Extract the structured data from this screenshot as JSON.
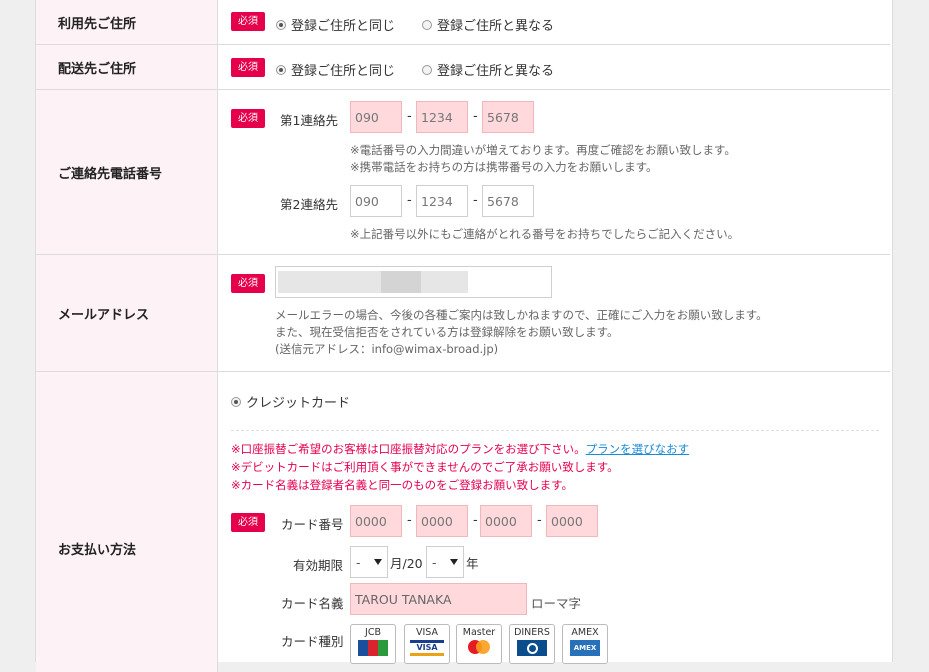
{
  "required_label": "必須",
  "rows": {
    "usage_address": {
      "label": "利用先ご住所",
      "option_same": "登録ご住所と同じ",
      "option_diff": "登録ご住所と異なる"
    },
    "delivery_address": {
      "label": "配送先ご住所",
      "option_same": "登録ご住所と同じ",
      "option_diff": "登録ご住所と異なる"
    },
    "phone": {
      "label": "ご連絡先電話番号",
      "first_label": "第1連絡先",
      "first_values": [
        "090",
        "1234",
        "5678"
      ],
      "first_notes": [
        "※電話番号の入力間違いが増えております。再度ご確認をお願い致します。",
        "※携帯電話をお持ちの方は携帯番号の入力をお願いします。"
      ],
      "second_label": "第2連絡先",
      "second_values": [
        "090",
        "1234",
        "5678"
      ],
      "second_note": "※上記番号以外にもご連絡がとれる番号をお持ちでしたらご記入ください。",
      "separator": "-"
    },
    "email": {
      "label": "メールアドレス",
      "notes": [
        "メールエラーの場合、今後の各種ご案内は致しかねますので、正確にご入力をお願い致します。",
        "また、現在受信拒否をされている方は登録解除をお願い致します。",
        "(送信元アドレス：info@wimax-broad.jp)"
      ]
    },
    "payment": {
      "label": "お支払い方法",
      "method": "クレジットカード",
      "warning1_prefix": "※口座振替ご希望のお客様は口座振替対応のプランをお選び下さい。",
      "warning1_link": "プランを選びなおす",
      "warning2": "※デビットカードはご利用頂く事ができませんのでご了承お願い致します。",
      "warning3": "※カード名義は登録者名義と同一のものをご登録お願い致します。",
      "card_number_label": "カード番号",
      "card_number_values": [
        "0000",
        "0000",
        "0000",
        "0000"
      ],
      "expiry_label": "有効期限",
      "expiry_month": "-",
      "expiry_month_suffix": "月/20",
      "expiry_year": "-",
      "expiry_year_suffix": "年",
      "card_name_label": "カード名義",
      "card_name_value": "TAROU TANAKA",
      "card_name_hint": "ローマ字",
      "card_type_label": "カード種別",
      "card_types": [
        "JCB",
        "VISA",
        "Master",
        "DINERS",
        "AMEX"
      ]
    }
  },
  "colors": {
    "required_badge": "#e6004c",
    "label_bg": "#fdf2f5",
    "input_filled": "#ffd9dc",
    "link": "#1a8bd6"
  }
}
